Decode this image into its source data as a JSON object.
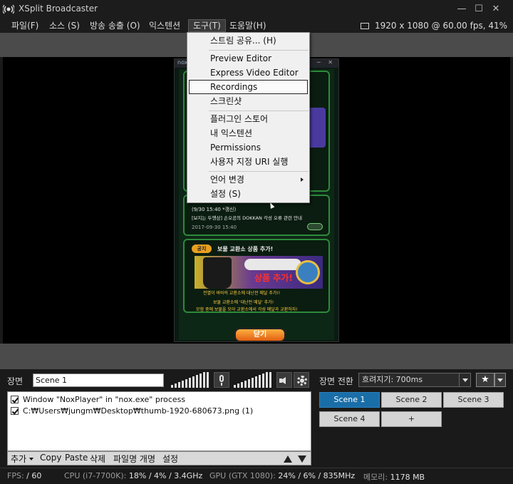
{
  "window": {
    "title": "XSplit Broadcaster",
    "min": "—",
    "max": "☐",
    "close": "✕"
  },
  "menu": {
    "items": [
      "파일(F)",
      "소스 (S)",
      "방송 송출 (O)",
      "익스텐션",
      "도구(T)",
      "도움말(H)"
    ],
    "resolution": "1920 x 1080 @ 60.00 fps, 41%"
  },
  "tools_menu": {
    "items": [
      "스트림 공유... (H)",
      "Preview Editor",
      "Express Video Editor",
      "Recordings",
      "스크린샷",
      "플러그인 스토어",
      "내 익스텐션",
      "Permissions",
      "사용자 지정 URI 실행",
      "언어 변경",
      "설정 (S)"
    ],
    "highlighted": "Recordings"
  },
  "nox": {
    "logo": "nox",
    "window_controls": "▭ ─ ✕",
    "notice_date": "(9/30 15:40 *갱신)",
    "notice_title": "[보지는 두행삼] 손오공의 DOKKAN 각성 오류 관련 안내",
    "notice_time": "2017-09-30 15:40",
    "tag": "공지",
    "card_title": "보물 교환소 상품 추가!",
    "banner_text": "상품 추가!",
    "banner_sub": "전멸이 바바의 교환소에 대난전 메달 추가!!",
    "desc1": "보물 교환소에 '대난전 메달' 추가!",
    "desc2": "모험 중에 보물을 모아 교환소에서 각성 메달과 교환하자!",
    "close_btn": "닫기"
  },
  "scene": {
    "label": "장면",
    "name": "Scene 1"
  },
  "sources": [
    {
      "label": "Window \"NoxPlayer\" in \"nox.exe\" process",
      "checked": true
    },
    {
      "label": "C:₩Users₩jungm₩Desktop₩thumb-1920-680673.png (1)",
      "checked": true
    }
  ],
  "source_toolbar": {
    "add": "추가",
    "copy": "Copy",
    "paste": "Paste",
    "delete": "삭제",
    "rename": "파일명 개명",
    "settings": "설정"
  },
  "transition": {
    "label": "장면 전환",
    "value": "흐려지기: 700ms"
  },
  "scenes": [
    {
      "label": "Scene 1",
      "active": true
    },
    {
      "label": "Scene 2",
      "active": false
    },
    {
      "label": "Scene 3",
      "active": false
    },
    {
      "label": "Scene 4",
      "active": false
    },
    {
      "label": "+",
      "active": false
    }
  ],
  "status": {
    "fps_label": "FPS:",
    "fps_value": "/ 60",
    "cpu_label": "CPU (i7-7700K):",
    "cpu_value": "18% / 4% / 3.4GHz",
    "gpu_label": "GPU (GTX 1080):",
    "gpu_value": "24% / 6% / 835MHz",
    "mem_label": "메모리:",
    "mem_value": "1178 MB"
  },
  "colors": {
    "accent": "#1a6ea8",
    "menu_bg": "#f0f0f0",
    "app_bg": "#1a1a1a"
  }
}
